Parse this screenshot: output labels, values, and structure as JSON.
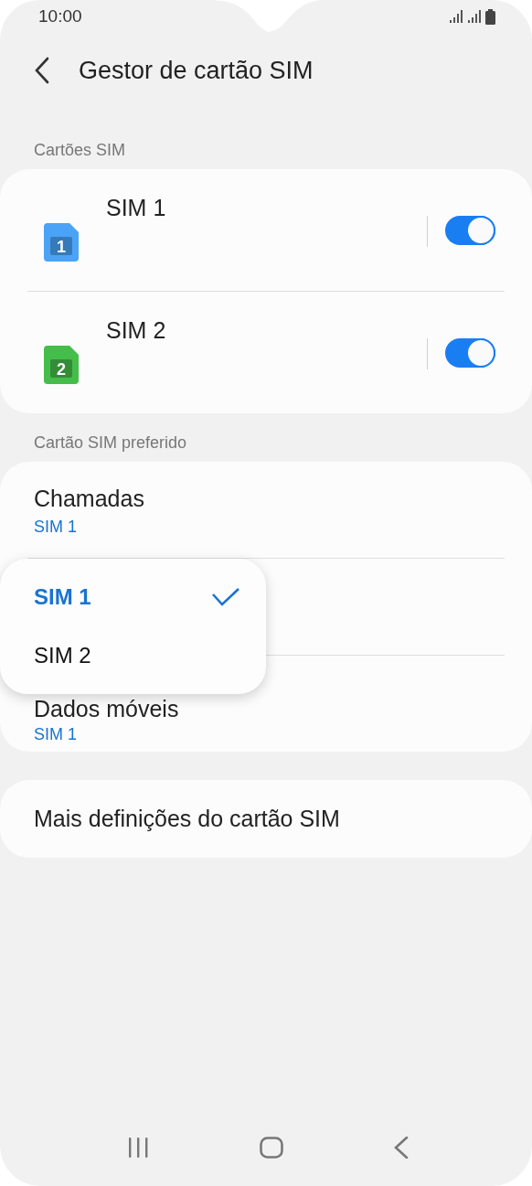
{
  "status_bar": {
    "time": "10:00"
  },
  "header": {
    "title": "Gestor de cartão SIM"
  },
  "sim_cards": {
    "heading": "Cartões SIM",
    "items": [
      {
        "name": "SIM 1",
        "number": "1",
        "color": "#4aa3f7",
        "on": true
      },
      {
        "name": "SIM 2",
        "number": "2",
        "color": "#45bd4a",
        "on": true
      }
    ]
  },
  "preferred": {
    "heading": "Cartão SIM preferido",
    "items": [
      {
        "label": "Chamadas",
        "value": "SIM 1"
      },
      {
        "label": "Dados móveis",
        "value": "SIM 1"
      }
    ]
  },
  "menu": {
    "options": [
      {
        "label": "SIM 1",
        "selected": true
      },
      {
        "label": "SIM 2",
        "selected": false
      }
    ]
  },
  "more": {
    "label": "Mais definições do cartão SIM"
  }
}
